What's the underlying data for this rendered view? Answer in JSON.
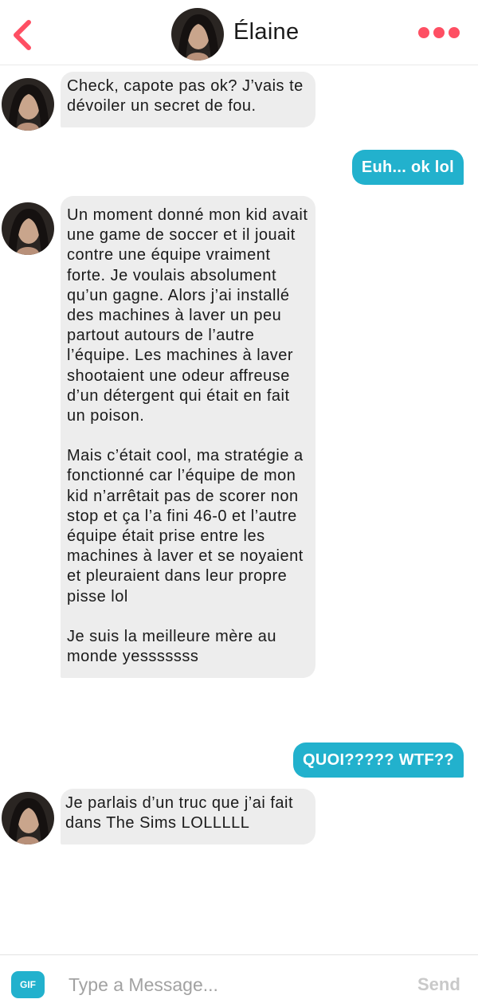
{
  "header": {
    "back_icon": "chevron-left-icon",
    "contact_name": "Élaine",
    "more_icon": "more-dots-icon",
    "accent_color": "#fe4f63"
  },
  "messages": [
    {
      "from": "contact",
      "paragraphs": [
        "Check, capote pas ok? J’vais te dévoiler un secret de fou."
      ]
    },
    {
      "from": "me",
      "text": "Euh... ok lol"
    },
    {
      "from": "contact",
      "paragraphs": [
        "Un moment donné mon kid avait une game de soccer et il jouait contre une équipe vraiment forte. Je voulais absolument qu’un gagne. Alors j’ai installé des machines à laver un peu partout autours de l’autre l’équipe. Les machines à laver shootaient une odeur affreuse d’un détergent qui était en fait un poison.",
        "Mais c’était cool, ma stratégie a fonctionné car l’équipe de mon kid n’arrêtait pas de scorer non stop et ça l’a fini 46-0 et l’autre équipe était prise entre les machines à laver et se noyaient et pleuraient dans leur propre pisse lol",
        "Je suis la meilleure mère au monde yesssssss"
      ]
    },
    {
      "from": "me",
      "text": "QUOI????? WTF??"
    },
    {
      "from": "contact",
      "paragraphs": [
        "Je parlais d’un truc que j’ai fait dans The Sims LOLLLLL"
      ]
    }
  ],
  "footer": {
    "gif_label": "GIF",
    "input_placeholder": "Type a Message...",
    "input_value": "",
    "send_label": "Send"
  },
  "colors": {
    "incoming_bubble": "#ededed",
    "outgoing_bubble": "#22b1cd",
    "send_disabled": "#c9c9c9"
  }
}
